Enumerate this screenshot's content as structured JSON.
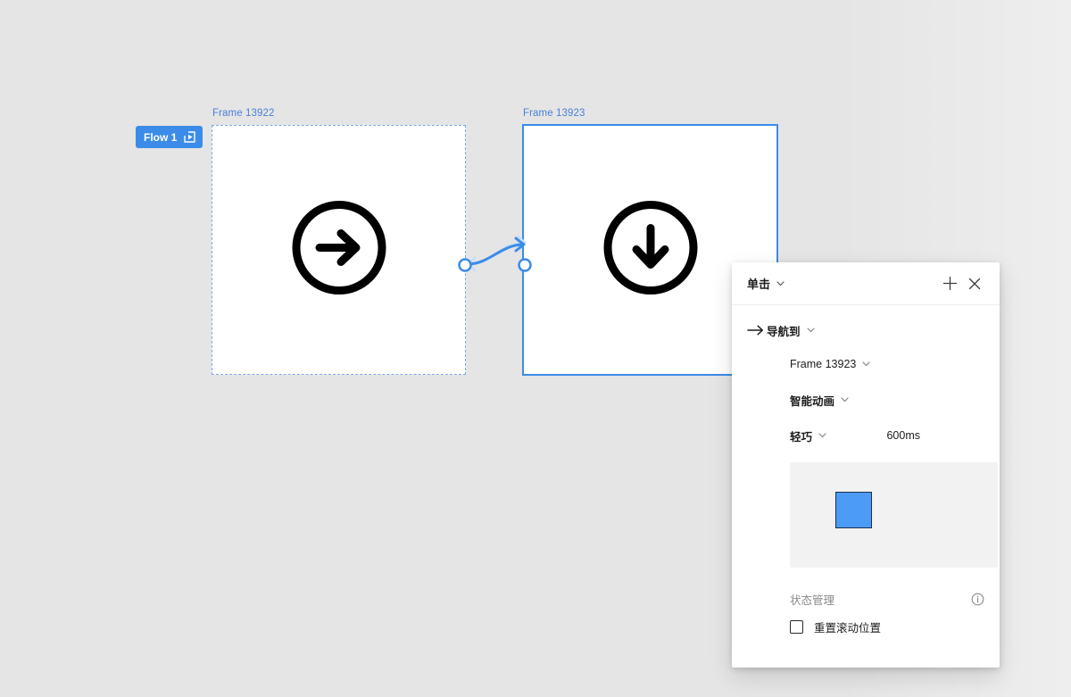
{
  "canvas": {
    "background_color": "#e5e5e5",
    "flow_badge": {
      "label": "Flow 1",
      "icon": "play-in-frame-icon",
      "color": "#3b8ce8"
    },
    "frames": [
      {
        "name": "Frame 13922",
        "icon": "arrow-right-circle-icon",
        "selected": false,
        "border_color": "#7aa7e8"
      },
      {
        "name": "Frame 13923",
        "icon": "arrow-down-circle-icon",
        "selected": true,
        "border_color": "#3b8ce8"
      }
    ],
    "connector": {
      "color": "#3b8ce8",
      "ghost_color": "#bdd9f7"
    }
  },
  "panel": {
    "header": {
      "trigger_label": "单击",
      "add_label": "+",
      "add_icon": "plus-icon",
      "close_icon": "close-icon"
    },
    "action": {
      "icon": "arrow-right-icon",
      "label": "导航到",
      "destination": "Frame 13923",
      "animation": "智能动画",
      "easing": "轻巧",
      "duration": "600ms"
    },
    "preview": {
      "square_color": "#4c9bf5",
      "square_border_color": "#1b2f4d",
      "background_color": "#f2f2f2"
    },
    "state_management": {
      "title": "状态管理",
      "info_icon": "info-icon",
      "checkbox_label": "重置滚动位置",
      "checkbox_checked": false
    }
  }
}
